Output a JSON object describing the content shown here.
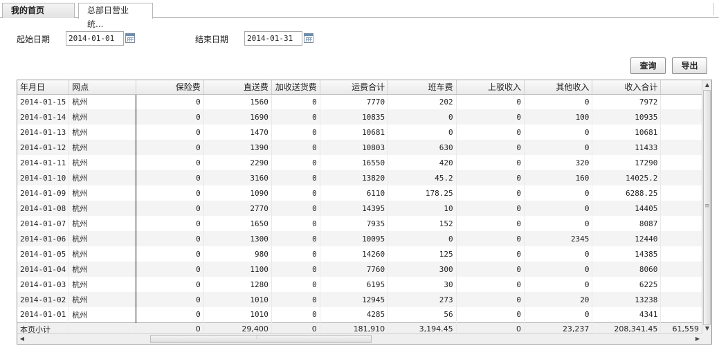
{
  "tabs": [
    {
      "label": "我的首页"
    },
    {
      "label": "总部日营业统..."
    }
  ],
  "filters": {
    "start_label": "起始日期",
    "start_value": "2014-01-01",
    "end_label": "结束日期",
    "end_value": "2014-01-31"
  },
  "buttons": {
    "query": "查询",
    "export": "导出"
  },
  "table": {
    "headers": [
      "年月日",
      "网点",
      "保险费",
      "直送费",
      "加收送货费",
      "运费合计",
      "班车费",
      "上驳收入",
      "其他收入",
      "收入合计",
      ""
    ],
    "rows": [
      [
        "2014-01-15",
        "杭州",
        "0",
        "1560",
        "0",
        "7770",
        "202",
        "0",
        "0",
        "7972"
      ],
      [
        "2014-01-14",
        "杭州",
        "0",
        "1690",
        "0",
        "10835",
        "0",
        "0",
        "100",
        "10935"
      ],
      [
        "2014-01-13",
        "杭州",
        "0",
        "1470",
        "0",
        "10681",
        "0",
        "0",
        "0",
        "10681"
      ],
      [
        "2014-01-12",
        "杭州",
        "0",
        "1390",
        "0",
        "10803",
        "630",
        "0",
        "0",
        "11433"
      ],
      [
        "2014-01-11",
        "杭州",
        "0",
        "2290",
        "0",
        "16550",
        "420",
        "0",
        "320",
        "17290"
      ],
      [
        "2014-01-10",
        "杭州",
        "0",
        "3160",
        "0",
        "13820",
        "45.2",
        "0",
        "160",
        "14025.2"
      ],
      [
        "2014-01-09",
        "杭州",
        "0",
        "1090",
        "0",
        "6110",
        "178.25",
        "0",
        "0",
        "6288.25"
      ],
      [
        "2014-01-08",
        "杭州",
        "0",
        "2770",
        "0",
        "14395",
        "10",
        "0",
        "0",
        "14405"
      ],
      [
        "2014-01-07",
        "杭州",
        "0",
        "1650",
        "0",
        "7935",
        "152",
        "0",
        "0",
        "8087"
      ],
      [
        "2014-01-06",
        "杭州",
        "0",
        "1300",
        "0",
        "10095",
        "0",
        "0",
        "2345",
        "12440"
      ],
      [
        "2014-01-05",
        "杭州",
        "0",
        "980",
        "0",
        "14260",
        "125",
        "0",
        "0",
        "14385"
      ],
      [
        "2014-01-04",
        "杭州",
        "0",
        "1100",
        "0",
        "7760",
        "300",
        "0",
        "0",
        "8060"
      ],
      [
        "2014-01-03",
        "杭州",
        "0",
        "1280",
        "0",
        "6195",
        "30",
        "0",
        "0",
        "6225"
      ],
      [
        "2014-01-02",
        "杭州",
        "0",
        "1010",
        "0",
        "12945",
        "273",
        "0",
        "20",
        "13238"
      ],
      [
        "2014-01-01",
        "杭州",
        "0",
        "1010",
        "0",
        "4285",
        "56",
        "0",
        "0",
        "4341"
      ]
    ],
    "footer": [
      "本页小计",
      "",
      "0",
      "29,400",
      "0",
      "181,910",
      "3,194.45",
      "0",
      "23,237",
      "208,341.45",
      "61,559"
    ]
  }
}
